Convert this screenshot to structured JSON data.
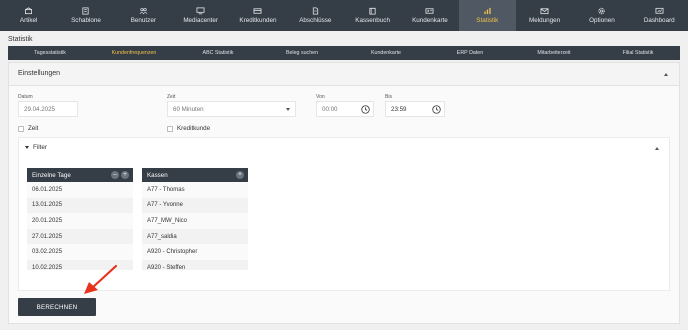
{
  "topnav": {
    "items": [
      {
        "label": "Artikel",
        "icon": "box-icon"
      },
      {
        "label": "Schablone",
        "icon": "template-icon"
      },
      {
        "label": "Benutzer",
        "icon": "users-icon"
      },
      {
        "label": "Mediacenter",
        "icon": "monitor-icon"
      },
      {
        "label": "Kreditkunden",
        "icon": "card-icon"
      },
      {
        "label": "Abschlüsse",
        "icon": "document-icon"
      },
      {
        "label": "Kassenbuch",
        "icon": "book-icon"
      },
      {
        "label": "Kundenkarte",
        "icon": "id-card-icon"
      },
      {
        "label": "Statistik",
        "icon": "chart-icon"
      },
      {
        "label": "Meldungen",
        "icon": "mail-icon"
      },
      {
        "label": "Optionen",
        "icon": "gear-icon"
      },
      {
        "label": "Dashboard",
        "icon": "dashboard-icon"
      }
    ],
    "active_index": 8,
    "accent_color": "#f2c14a",
    "bg_color": "#353d47"
  },
  "page": {
    "title": "Statistik"
  },
  "subnav": {
    "items": [
      "Tagesstatistik",
      "Kundenfrequenzen",
      "ABC Statistik",
      "Beleg suchen",
      "Kundenkarte",
      "ERP Daten",
      "Mitarbeiterzeit",
      "Filial Statistik"
    ],
    "active_index": 1
  },
  "settings": {
    "title": "Einstellungen",
    "datum_label": "Datum",
    "datum_value": "29.04.2025",
    "zeit_label": "Zeit",
    "zeit_value": "60 Minuten",
    "von_label": "Von",
    "von_value": "00:00",
    "bis_label": "Bis",
    "bis_value": "23:59",
    "checkbox_zeit": "Zeit",
    "checkbox_kreditkunde": "Kreditkunde"
  },
  "filter": {
    "title": "Filter",
    "days": {
      "header": "Einzelne Tage",
      "items": [
        "06.01.2025",
        "13.01.2025",
        "20.01.2025",
        "27.01.2025",
        "03.02.2025",
        "10.02.2025"
      ]
    },
    "kassen": {
      "header": "Kassen",
      "items": [
        "A77 - Thomas",
        "A77 - Yvonne",
        "A77_MW_Nico",
        "A77_saldia",
        "A920 - Christopher",
        "A920 - Steffen"
      ]
    }
  },
  "button": {
    "label": "BERECHNEN"
  }
}
